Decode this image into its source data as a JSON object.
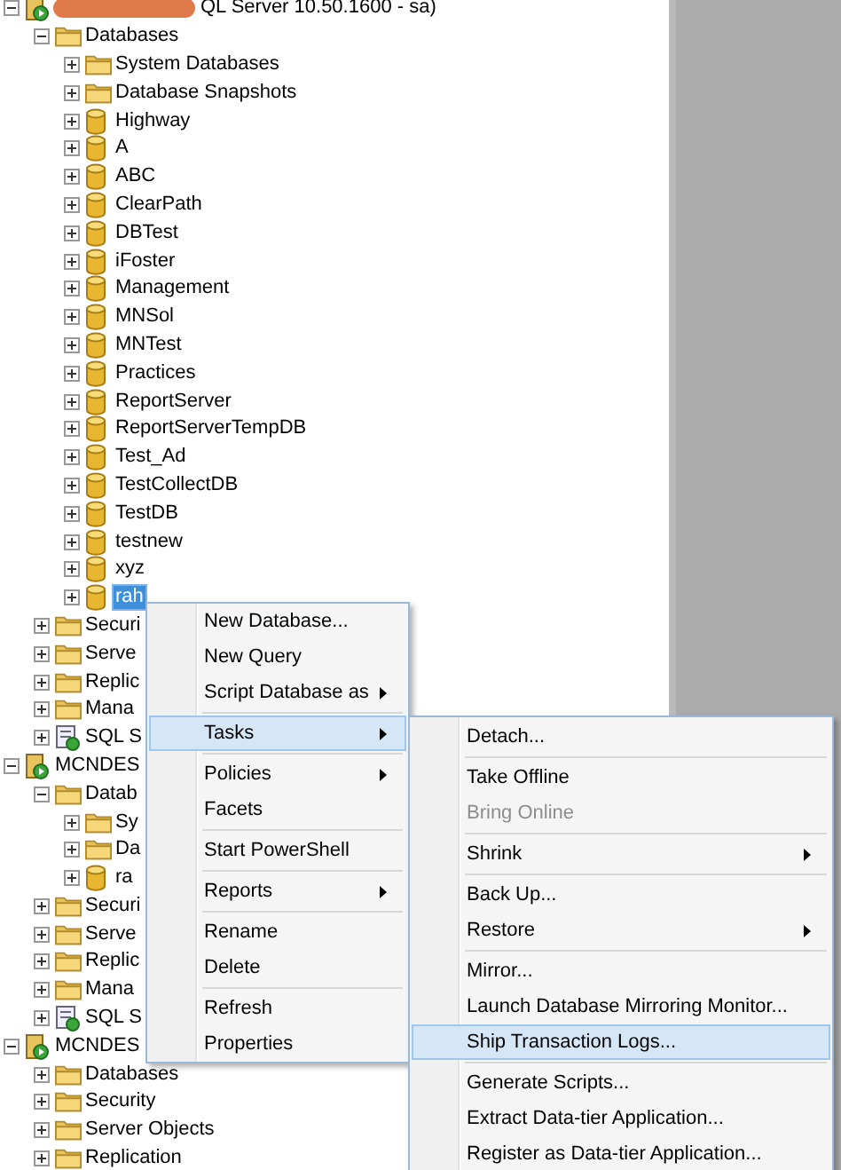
{
  "tree": [
    {
      "label": "QL Server 10.50.1600 - sa)",
      "kind": "server",
      "expanded": true,
      "selected": false,
      "redacted": true,
      "children": [
        {
          "label": "Databases",
          "kind": "folder",
          "expanded": true,
          "selected": false,
          "children": [
            {
              "label": "System Databases",
              "kind": "folder",
              "expanded": false,
              "selected": false
            },
            {
              "label": "Database Snapshots",
              "kind": "folder",
              "expanded": false,
              "selected": false
            },
            {
              "label": "Highway",
              "kind": "database",
              "expanded": false,
              "selected": false
            },
            {
              "label": "A",
              "kind": "database",
              "expanded": false,
              "selected": false
            },
            {
              "label": "ABC",
              "kind": "database",
              "expanded": false,
              "selected": false
            },
            {
              "label": "ClearPath",
              "kind": "database",
              "expanded": false,
              "selected": false
            },
            {
              "label": "DBTest",
              "kind": "database",
              "expanded": false,
              "selected": false
            },
            {
              "label": "iFoster",
              "kind": "database",
              "expanded": false,
              "selected": false
            },
            {
              "label": "Management",
              "kind": "database",
              "expanded": false,
              "selected": false
            },
            {
              "label": "MNSol",
              "kind": "database",
              "expanded": false,
              "selected": false
            },
            {
              "label": "MNTest",
              "kind": "database",
              "expanded": false,
              "selected": false
            },
            {
              "label": "Practices",
              "kind": "database",
              "expanded": false,
              "selected": false
            },
            {
              "label": "ReportServer",
              "kind": "database",
              "expanded": false,
              "selected": false
            },
            {
              "label": "ReportServerTempDB",
              "kind": "database",
              "expanded": false,
              "selected": false
            },
            {
              "label": "Test_Ad",
              "kind": "database",
              "expanded": false,
              "selected": false
            },
            {
              "label": "TestCollectDB",
              "kind": "database",
              "expanded": false,
              "selected": false
            },
            {
              "label": "TestDB",
              "kind": "database",
              "expanded": false,
              "selected": false
            },
            {
              "label": "testnew",
              "kind": "database",
              "expanded": false,
              "selected": false
            },
            {
              "label": "xyz",
              "kind": "database",
              "expanded": false,
              "selected": false
            },
            {
              "label": "rah",
              "kind": "database",
              "expanded": false,
              "selected": true
            }
          ]
        },
        {
          "label": "Securi",
          "kind": "folder",
          "expanded": false,
          "selected": false
        },
        {
          "label": "Serve",
          "kind": "folder",
          "expanded": false,
          "selected": false
        },
        {
          "label": "Replic",
          "kind": "folder",
          "expanded": false,
          "selected": false
        },
        {
          "label": "Mana",
          "kind": "folder",
          "expanded": false,
          "selected": false
        },
        {
          "label": "SQL S",
          "kind": "agent",
          "expanded": false,
          "selected": false
        }
      ]
    },
    {
      "label": "MCNDES",
      "kind": "server",
      "expanded": true,
      "selected": false,
      "children": [
        {
          "label": "Datab",
          "kind": "folder",
          "expanded": true,
          "selected": false,
          "children": [
            {
              "label": "Sy",
              "kind": "folder",
              "expanded": false,
              "selected": false
            },
            {
              "label": "Da",
              "kind": "folder",
              "expanded": false,
              "selected": false
            },
            {
              "label": "ra",
              "kind": "database",
              "expanded": false,
              "selected": false
            }
          ]
        },
        {
          "label": "Securi",
          "kind": "folder",
          "expanded": false,
          "selected": false
        },
        {
          "label": "Serve",
          "kind": "folder",
          "expanded": false,
          "selected": false
        },
        {
          "label": "Replic",
          "kind": "folder",
          "expanded": false,
          "selected": false
        },
        {
          "label": "Mana",
          "kind": "folder",
          "expanded": false,
          "selected": false
        },
        {
          "label": "SQL S",
          "kind": "agent",
          "expanded": false,
          "selected": false
        }
      ]
    },
    {
      "label": "MCNDES",
      "kind": "server",
      "expanded": true,
      "selected": false,
      "children": [
        {
          "label": "Databases",
          "kind": "folder",
          "expanded": false,
          "selected": false
        },
        {
          "label": "Security",
          "kind": "folder",
          "expanded": false,
          "selected": false
        },
        {
          "label": "Server Objects",
          "kind": "folder",
          "expanded": false,
          "selected": false
        },
        {
          "label": "Replication",
          "kind": "folder",
          "expanded": false,
          "selected": false
        }
      ]
    }
  ],
  "context_menu": [
    {
      "kind": "item",
      "label": "New Database...",
      "submenu": false,
      "selected": false,
      "disabled": false
    },
    {
      "kind": "item",
      "label": "New Query",
      "submenu": false,
      "selected": false,
      "disabled": false
    },
    {
      "kind": "item",
      "label": "Script Database as",
      "submenu": true,
      "selected": false,
      "disabled": false
    },
    {
      "kind": "separator"
    },
    {
      "kind": "item",
      "label": "Tasks",
      "submenu": true,
      "selected": true,
      "disabled": false
    },
    {
      "kind": "separator"
    },
    {
      "kind": "item",
      "label": "Policies",
      "submenu": true,
      "selected": false,
      "disabled": false
    },
    {
      "kind": "item",
      "label": "Facets",
      "submenu": false,
      "selected": false,
      "disabled": false
    },
    {
      "kind": "separator"
    },
    {
      "kind": "item",
      "label": "Start PowerShell",
      "submenu": false,
      "selected": false,
      "disabled": false
    },
    {
      "kind": "separator"
    },
    {
      "kind": "item",
      "label": "Reports",
      "submenu": true,
      "selected": false,
      "disabled": false
    },
    {
      "kind": "separator"
    },
    {
      "kind": "item",
      "label": "Rename",
      "submenu": false,
      "selected": false,
      "disabled": false
    },
    {
      "kind": "item",
      "label": "Delete",
      "submenu": false,
      "selected": false,
      "disabled": false
    },
    {
      "kind": "separator"
    },
    {
      "kind": "item",
      "label": "Refresh",
      "submenu": false,
      "selected": false,
      "disabled": false
    },
    {
      "kind": "item",
      "label": "Properties",
      "submenu": false,
      "selected": false,
      "disabled": false
    }
  ],
  "tasks_submenu": [
    {
      "kind": "item",
      "label": "Detach...",
      "submenu": false,
      "selected": false,
      "disabled": false
    },
    {
      "kind": "separator"
    },
    {
      "kind": "item",
      "label": "Take Offline",
      "submenu": false,
      "selected": false,
      "disabled": false
    },
    {
      "kind": "item",
      "label": "Bring Online",
      "submenu": false,
      "selected": false,
      "disabled": true
    },
    {
      "kind": "separator"
    },
    {
      "kind": "item",
      "label": "Shrink",
      "submenu": true,
      "selected": false,
      "disabled": false
    },
    {
      "kind": "separator"
    },
    {
      "kind": "item",
      "label": "Back Up...",
      "submenu": false,
      "selected": false,
      "disabled": false
    },
    {
      "kind": "item",
      "label": "Restore",
      "submenu": true,
      "selected": false,
      "disabled": false
    },
    {
      "kind": "separator"
    },
    {
      "kind": "item",
      "label": "Mirror...",
      "submenu": false,
      "selected": false,
      "disabled": false
    },
    {
      "kind": "item",
      "label": "Launch Database Mirroring Monitor...",
      "submenu": false,
      "selected": false,
      "disabled": false
    },
    {
      "kind": "item",
      "label": "Ship Transaction Logs...",
      "submenu": false,
      "selected": true,
      "disabled": false
    },
    {
      "kind": "separator"
    },
    {
      "kind": "item",
      "label": "Generate Scripts...",
      "submenu": false,
      "selected": false,
      "disabled": false
    },
    {
      "kind": "item",
      "label": "Extract Data-tier Application...",
      "submenu": false,
      "selected": false,
      "disabled": false
    },
    {
      "kind": "item",
      "label": "Register as Data-tier Application...",
      "submenu": false,
      "selected": false,
      "disabled": false
    }
  ]
}
